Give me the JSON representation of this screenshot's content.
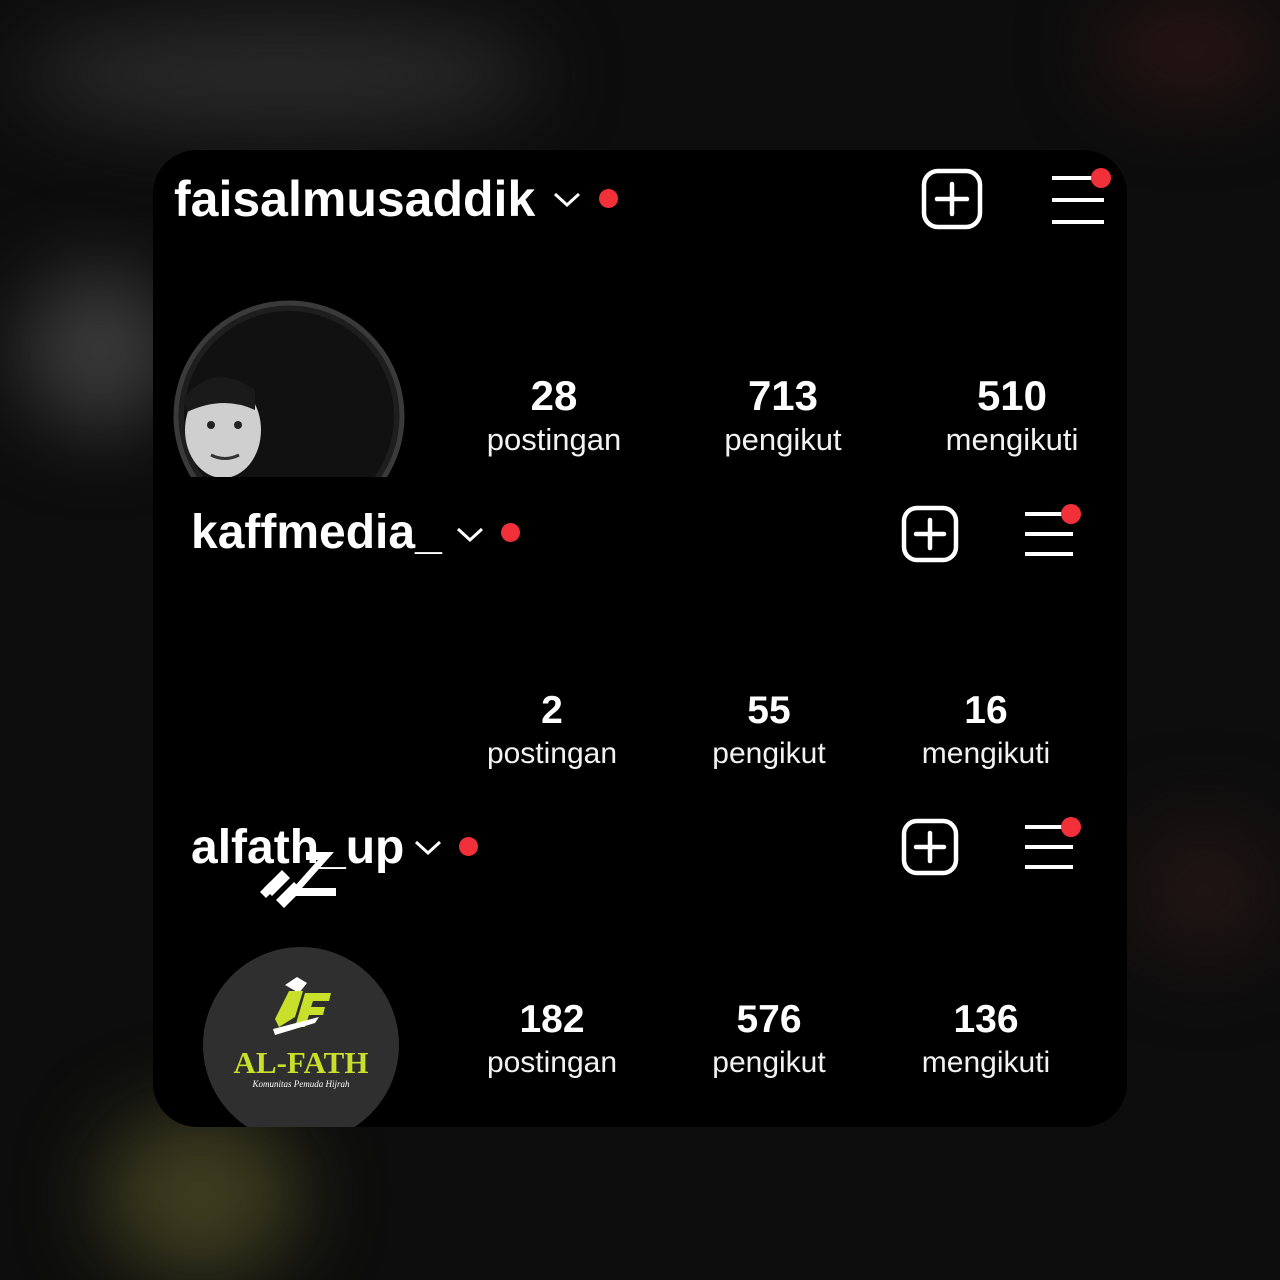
{
  "profiles": [
    {
      "username": "faisalmusaddik",
      "stats": [
        {
          "value": "28",
          "label": "postingan"
        },
        {
          "value": "713",
          "label": "pengikut"
        },
        {
          "value": "510",
          "label": "mengikuti"
        }
      ],
      "avatar_icon": "person-photo-avatar"
    },
    {
      "username": "kaffmedia_",
      "stats": [
        {
          "value": "2",
          "label": "postingan"
        },
        {
          "value": "55",
          "label": "pengikut"
        },
        {
          "value": "16",
          "label": "mengikuti"
        }
      ],
      "avatar_icon": "kaff-logo-icon"
    },
    {
      "username": "alfath_up",
      "stats": [
        {
          "value": "182",
          "label": "postingan"
        },
        {
          "value": "576",
          "label": "pengikut"
        },
        {
          "value": "136",
          "label": "mengikuti"
        }
      ],
      "avatar_icon": "al-fath-logo",
      "logo_text": "AL-FATH",
      "logo_subtext": "Komunitas Pemuda Hijrah"
    }
  ],
  "colors": {
    "background": "#000000",
    "text": "#ffffff",
    "notification_dot": "#f2303a",
    "logo_accent": "#c8e02a"
  }
}
